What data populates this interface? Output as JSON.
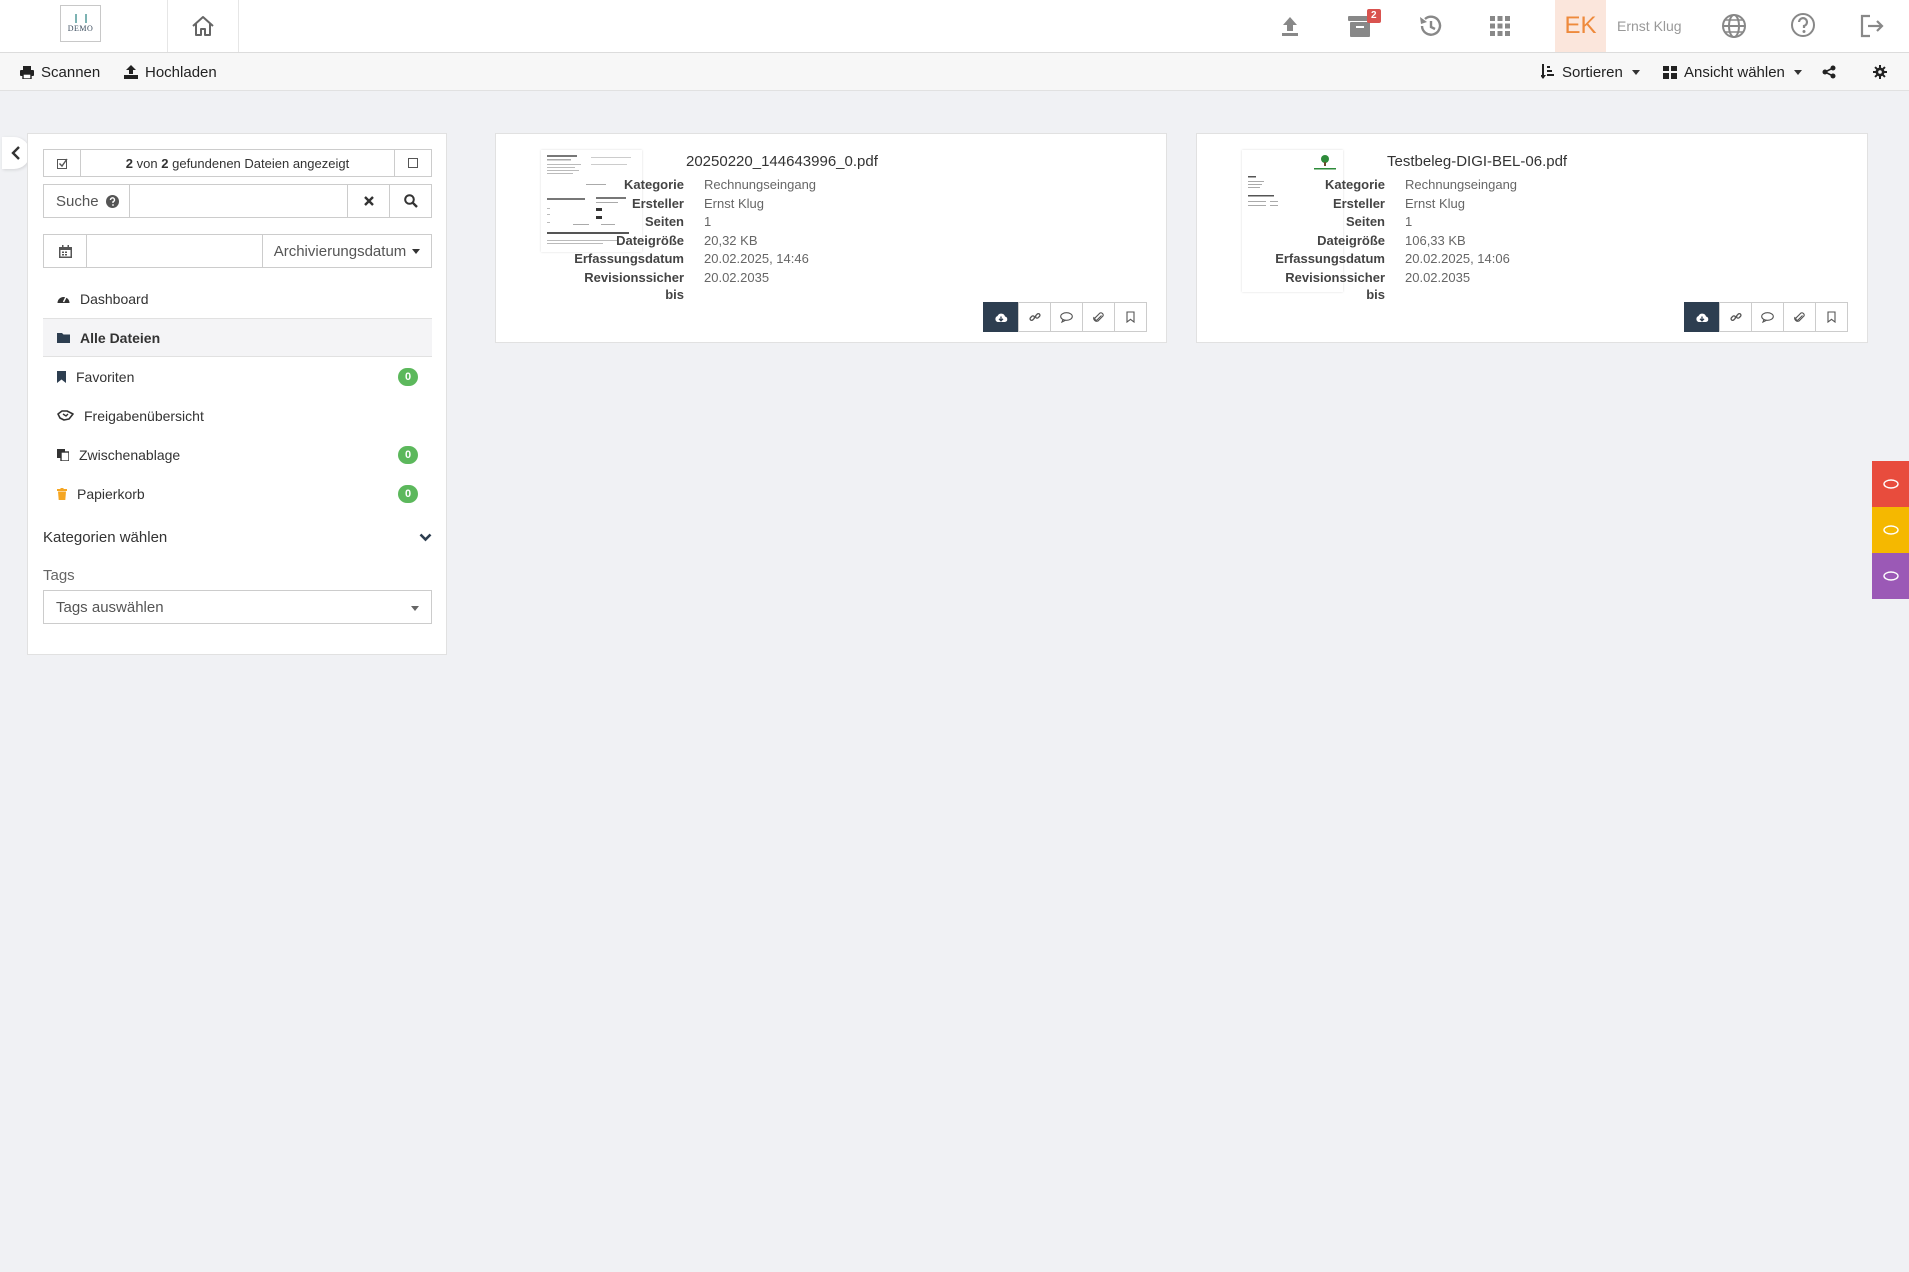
{
  "header": {
    "logo_text": "DEMO",
    "archive_badge": "2",
    "avatar_initials": "EK",
    "username": "Ernst Klug"
  },
  "toolbar": {
    "scan_label": "Scannen",
    "upload_label": "Hochladen",
    "sort_label": "Sortieren",
    "view_label": "Ansicht wählen"
  },
  "sidebar": {
    "count_shown": "2",
    "count_total": "2",
    "count_von": "von",
    "count_suffix": "gefundenen Dateien angezeigt",
    "search_label": "Suche",
    "search_value": "",
    "date_value": "",
    "date_filter_label": "Archivierungsdatum",
    "menu": [
      {
        "label": "Dashboard"
      },
      {
        "label": "Alle Dateien"
      },
      {
        "label": "Favoriten",
        "count": "0"
      },
      {
        "label": "Freigabenübersicht"
      },
      {
        "label": "Zwischenablage",
        "count": "0"
      },
      {
        "label": "Papierkorb",
        "count": "0"
      }
    ],
    "categories_label": "Kategorien wählen",
    "tags_label": "Tags",
    "tags_placeholder": "Tags auswählen"
  },
  "field_labels": {
    "category": "Kategorie",
    "creator": "Ersteller",
    "pages": "Seiten",
    "size": "Dateigröße",
    "captured": "Erfassungsdatum",
    "retention": "Revisionssicher bis"
  },
  "files": [
    {
      "name": "20250220_144643996_0.pdf",
      "category": "Rechnungseingang",
      "creator": "Ernst Klug",
      "pages": "1",
      "size": "20,32 KB",
      "captured": "20.02.2025, 14:46",
      "retention": "20.02.2035"
    },
    {
      "name": "Testbeleg-DIGI-BEL-06.pdf",
      "category": "Rechnungseingang",
      "creator": "Ernst Klug",
      "pages": "1",
      "size": "106,33 KB",
      "captured": "20.02.2025, 14:06",
      "retention": "20.02.2035"
    }
  ],
  "colors": {
    "accent_dark": "#2d3e50",
    "badge_green": "#5cb85c",
    "badge_red": "#d9534f",
    "tab_red": "#e84c3d",
    "tab_yellow": "#f5b800",
    "tab_purple": "#9b59b6"
  }
}
